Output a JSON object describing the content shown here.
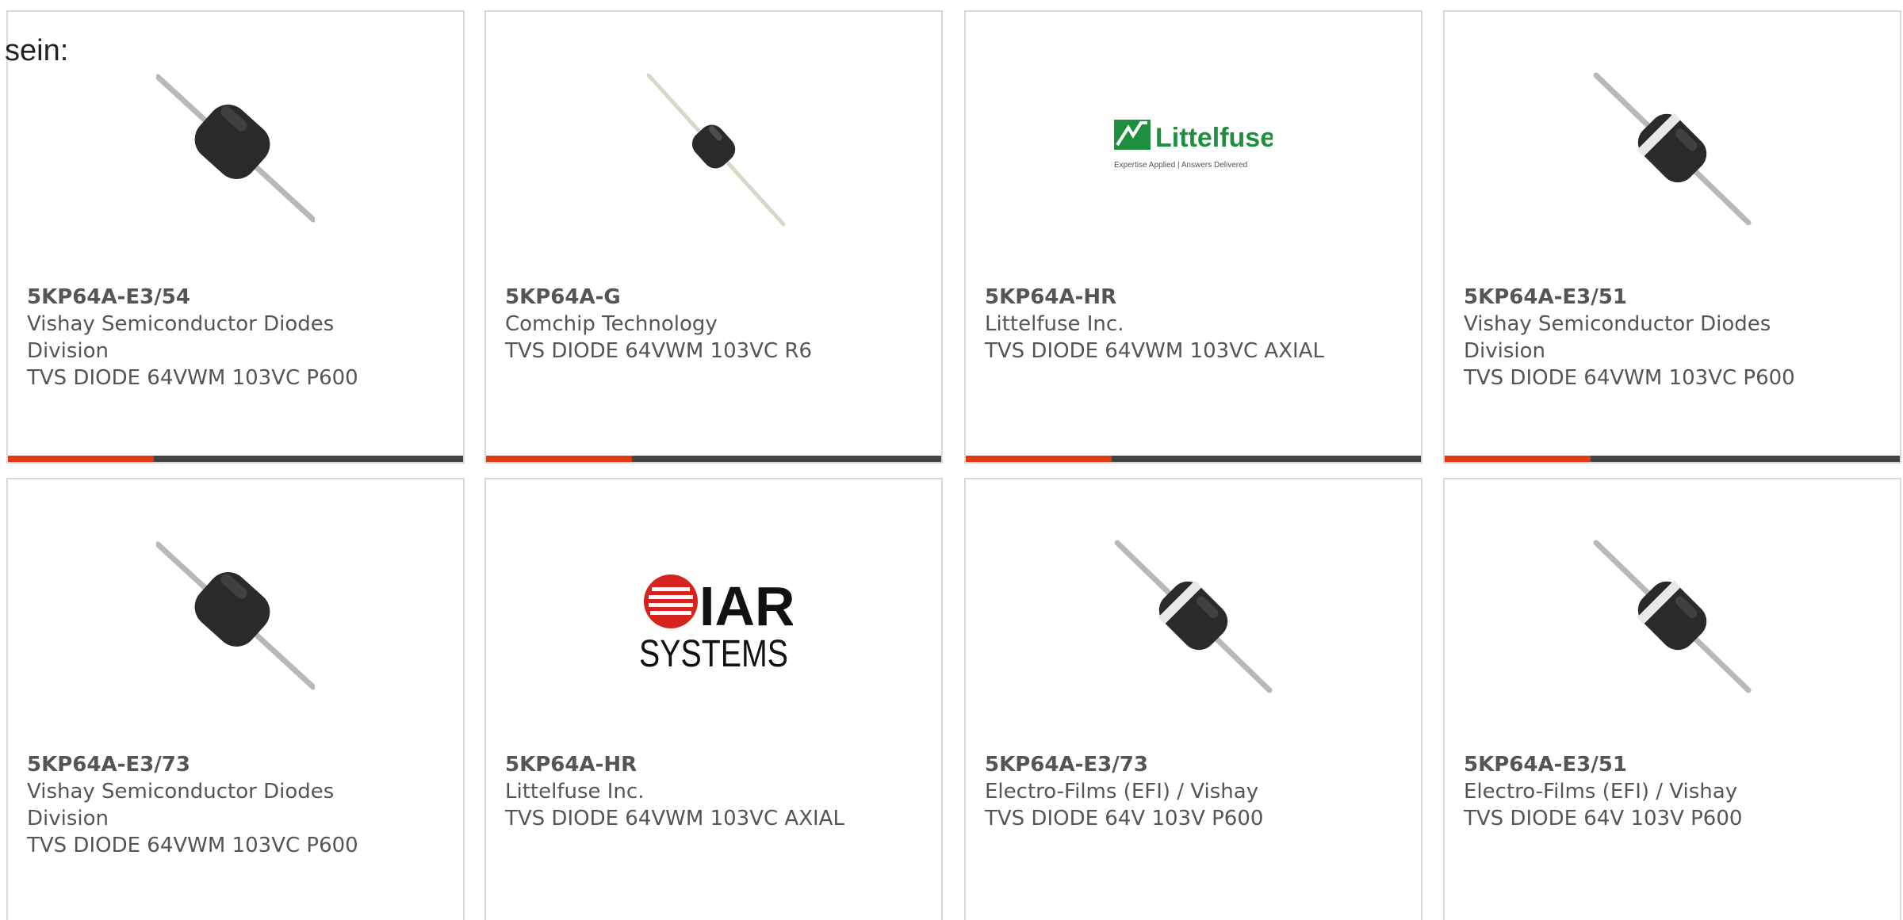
{
  "intro_text": "sein:",
  "accent_color": "#e03a12",
  "bar_color": "#444444",
  "products": [
    {
      "part_number": "5KP64A-E3/54",
      "manufacturer": "Vishay Semiconductor Diodes Division",
      "description": "TVS DIODE 64VWM 103VC P600",
      "image": "axial-diode-black-icon",
      "rating_fraction": 0.32
    },
    {
      "part_number": "5KP64A-G",
      "manufacturer": "Comchip Technology",
      "description": "TVS DIODE 64VWM 103VC R6",
      "image": "axial-diode-small-icon",
      "rating_fraction": 0.32
    },
    {
      "part_number": "5KP64A-HR",
      "manufacturer": "Littelfuse Inc.",
      "description": "TVS DIODE 64VWM 103VC AXIAL",
      "image": "littelfuse-logo",
      "logo_text": "Littelfuse",
      "logo_tagline": "Expertise Applied | Answers Delivered",
      "rating_fraction": 0.32
    },
    {
      "part_number": "5KP64A-E3/51",
      "manufacturer": "Vishay Semiconductor Diodes Division",
      "description": "TVS DIODE 64VWM 103VC P600",
      "image": "axial-diode-banded-icon",
      "rating_fraction": 0.32
    },
    {
      "part_number": "5KP64A-E3/73",
      "manufacturer": "Vishay Semiconductor Diodes Division",
      "description": "TVS DIODE 64VWM 103VC P600",
      "image": "axial-diode-black-icon"
    },
    {
      "part_number": "5KP64A-HR",
      "manufacturer": "Littelfuse Inc.",
      "description": "TVS DIODE 64VWM 103VC AXIAL",
      "image": "iar-systems-logo",
      "logo_text": "IAR",
      "logo_subtext": "SYSTEMS"
    },
    {
      "part_number": "5KP64A-E3/73",
      "manufacturer": "Electro-Films (EFI) / Vishay",
      "description": "TVS DIODE 64V 103V P600",
      "image": "axial-diode-banded-icon"
    },
    {
      "part_number": "5KP64A-E3/51",
      "manufacturer": "Electro-Films (EFI) / Vishay",
      "description": "TVS DIODE 64V 103V P600",
      "image": "axial-diode-banded-icon"
    }
  ]
}
